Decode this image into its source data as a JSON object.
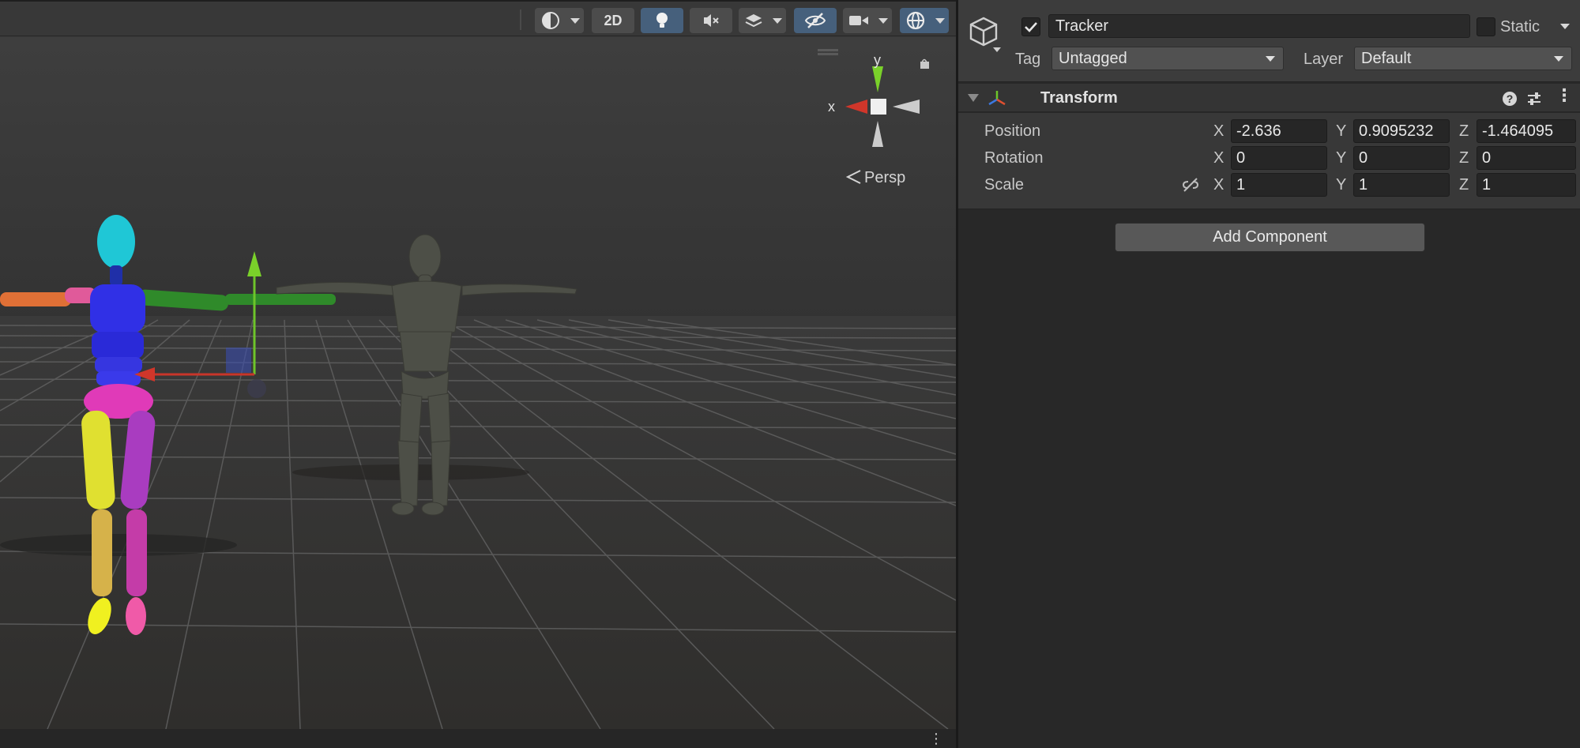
{
  "scene": {
    "toolbar": {
      "mode_2d_label": "2D"
    },
    "gizmo": {
      "y_label": "y",
      "x_label": "x",
      "projection_label": "Persp"
    },
    "colors": {
      "axis_x": "#d0362a",
      "axis_y": "#7ad12a",
      "toolbar_active": "#46607c"
    }
  },
  "inspector": {
    "object_name": "Tracker",
    "active_checked": true,
    "static_label": "Static",
    "static_checked": false,
    "tag_label": "Tag",
    "tag_value": "Untagged",
    "layer_label": "Layer",
    "layer_value": "Default",
    "component": {
      "title": "Transform",
      "rows": [
        {
          "label": "Position",
          "x": "-2.636",
          "y": "0.9095232",
          "z": "-1.464095"
        },
        {
          "label": "Rotation",
          "x": "0",
          "y": "0",
          "z": "0"
        },
        {
          "label": "Scale",
          "x": "1",
          "y": "1",
          "z": "1"
        }
      ],
      "axis_labels": {
        "x": "X",
        "y": "Y",
        "z": "Z"
      }
    },
    "add_component_label": "Add Component"
  }
}
